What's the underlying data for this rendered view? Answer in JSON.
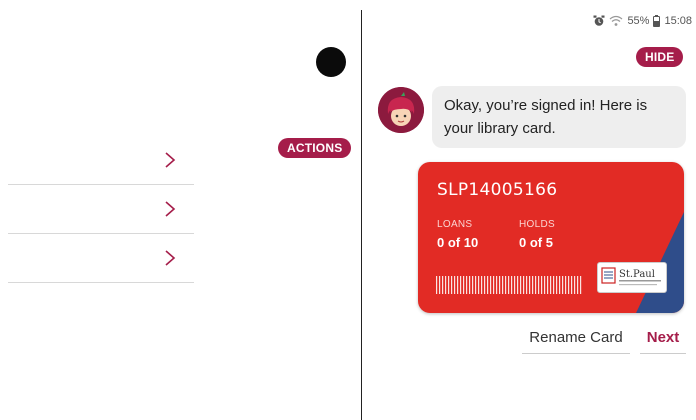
{
  "status_bar": {
    "battery": "55%",
    "time": "15:08"
  },
  "left_panel": {
    "actions_label": "ACTIONS"
  },
  "chat": {
    "hide_label": "HIDE",
    "message": "Okay, you’re signed in! Here is your library card."
  },
  "card": {
    "number": "SLP14005166",
    "loans_label": "LOANS",
    "loans_value": "0 of 10",
    "holds_label": "HOLDS",
    "holds_value": "0 of 5",
    "logo": "St.Paul",
    "colors": {
      "red": "#e22b25",
      "blue": "#2f4d8a"
    }
  },
  "buttons": {
    "rename": "Rename Card",
    "next": "Next"
  },
  "accent": "#a51d4a"
}
